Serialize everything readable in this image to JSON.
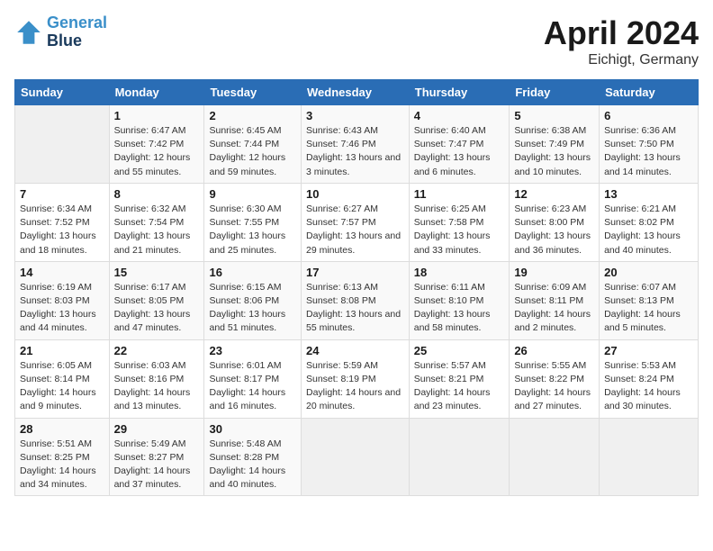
{
  "header": {
    "logo_line1": "General",
    "logo_line2": "Blue",
    "month": "April 2024",
    "location": "Eichigt, Germany"
  },
  "days_of_week": [
    "Sunday",
    "Monday",
    "Tuesday",
    "Wednesday",
    "Thursday",
    "Friday",
    "Saturday"
  ],
  "weeks": [
    [
      {
        "day": "",
        "sunrise": "",
        "sunset": "",
        "daylight": ""
      },
      {
        "day": "1",
        "sunrise": "Sunrise: 6:47 AM",
        "sunset": "Sunset: 7:42 PM",
        "daylight": "Daylight: 12 hours and 55 minutes."
      },
      {
        "day": "2",
        "sunrise": "Sunrise: 6:45 AM",
        "sunset": "Sunset: 7:44 PM",
        "daylight": "Daylight: 12 hours and 59 minutes."
      },
      {
        "day": "3",
        "sunrise": "Sunrise: 6:43 AM",
        "sunset": "Sunset: 7:46 PM",
        "daylight": "Daylight: 13 hours and 3 minutes."
      },
      {
        "day": "4",
        "sunrise": "Sunrise: 6:40 AM",
        "sunset": "Sunset: 7:47 PM",
        "daylight": "Daylight: 13 hours and 6 minutes."
      },
      {
        "day": "5",
        "sunrise": "Sunrise: 6:38 AM",
        "sunset": "Sunset: 7:49 PM",
        "daylight": "Daylight: 13 hours and 10 minutes."
      },
      {
        "day": "6",
        "sunrise": "Sunrise: 6:36 AM",
        "sunset": "Sunset: 7:50 PM",
        "daylight": "Daylight: 13 hours and 14 minutes."
      }
    ],
    [
      {
        "day": "7",
        "sunrise": "Sunrise: 6:34 AM",
        "sunset": "Sunset: 7:52 PM",
        "daylight": "Daylight: 13 hours and 18 minutes."
      },
      {
        "day": "8",
        "sunrise": "Sunrise: 6:32 AM",
        "sunset": "Sunset: 7:54 PM",
        "daylight": "Daylight: 13 hours and 21 minutes."
      },
      {
        "day": "9",
        "sunrise": "Sunrise: 6:30 AM",
        "sunset": "Sunset: 7:55 PM",
        "daylight": "Daylight: 13 hours and 25 minutes."
      },
      {
        "day": "10",
        "sunrise": "Sunrise: 6:27 AM",
        "sunset": "Sunset: 7:57 PM",
        "daylight": "Daylight: 13 hours and 29 minutes."
      },
      {
        "day": "11",
        "sunrise": "Sunrise: 6:25 AM",
        "sunset": "Sunset: 7:58 PM",
        "daylight": "Daylight: 13 hours and 33 minutes."
      },
      {
        "day": "12",
        "sunrise": "Sunrise: 6:23 AM",
        "sunset": "Sunset: 8:00 PM",
        "daylight": "Daylight: 13 hours and 36 minutes."
      },
      {
        "day": "13",
        "sunrise": "Sunrise: 6:21 AM",
        "sunset": "Sunset: 8:02 PM",
        "daylight": "Daylight: 13 hours and 40 minutes."
      }
    ],
    [
      {
        "day": "14",
        "sunrise": "Sunrise: 6:19 AM",
        "sunset": "Sunset: 8:03 PM",
        "daylight": "Daylight: 13 hours and 44 minutes."
      },
      {
        "day": "15",
        "sunrise": "Sunrise: 6:17 AM",
        "sunset": "Sunset: 8:05 PM",
        "daylight": "Daylight: 13 hours and 47 minutes."
      },
      {
        "day": "16",
        "sunrise": "Sunrise: 6:15 AM",
        "sunset": "Sunset: 8:06 PM",
        "daylight": "Daylight: 13 hours and 51 minutes."
      },
      {
        "day": "17",
        "sunrise": "Sunrise: 6:13 AM",
        "sunset": "Sunset: 8:08 PM",
        "daylight": "Daylight: 13 hours and 55 minutes."
      },
      {
        "day": "18",
        "sunrise": "Sunrise: 6:11 AM",
        "sunset": "Sunset: 8:10 PM",
        "daylight": "Daylight: 13 hours and 58 minutes."
      },
      {
        "day": "19",
        "sunrise": "Sunrise: 6:09 AM",
        "sunset": "Sunset: 8:11 PM",
        "daylight": "Daylight: 14 hours and 2 minutes."
      },
      {
        "day": "20",
        "sunrise": "Sunrise: 6:07 AM",
        "sunset": "Sunset: 8:13 PM",
        "daylight": "Daylight: 14 hours and 5 minutes."
      }
    ],
    [
      {
        "day": "21",
        "sunrise": "Sunrise: 6:05 AM",
        "sunset": "Sunset: 8:14 PM",
        "daylight": "Daylight: 14 hours and 9 minutes."
      },
      {
        "day": "22",
        "sunrise": "Sunrise: 6:03 AM",
        "sunset": "Sunset: 8:16 PM",
        "daylight": "Daylight: 14 hours and 13 minutes."
      },
      {
        "day": "23",
        "sunrise": "Sunrise: 6:01 AM",
        "sunset": "Sunset: 8:17 PM",
        "daylight": "Daylight: 14 hours and 16 minutes."
      },
      {
        "day": "24",
        "sunrise": "Sunrise: 5:59 AM",
        "sunset": "Sunset: 8:19 PM",
        "daylight": "Daylight: 14 hours and 20 minutes."
      },
      {
        "day": "25",
        "sunrise": "Sunrise: 5:57 AM",
        "sunset": "Sunset: 8:21 PM",
        "daylight": "Daylight: 14 hours and 23 minutes."
      },
      {
        "day": "26",
        "sunrise": "Sunrise: 5:55 AM",
        "sunset": "Sunset: 8:22 PM",
        "daylight": "Daylight: 14 hours and 27 minutes."
      },
      {
        "day": "27",
        "sunrise": "Sunrise: 5:53 AM",
        "sunset": "Sunset: 8:24 PM",
        "daylight": "Daylight: 14 hours and 30 minutes."
      }
    ],
    [
      {
        "day": "28",
        "sunrise": "Sunrise: 5:51 AM",
        "sunset": "Sunset: 8:25 PM",
        "daylight": "Daylight: 14 hours and 34 minutes."
      },
      {
        "day": "29",
        "sunrise": "Sunrise: 5:49 AM",
        "sunset": "Sunset: 8:27 PM",
        "daylight": "Daylight: 14 hours and 37 minutes."
      },
      {
        "day": "30",
        "sunrise": "Sunrise: 5:48 AM",
        "sunset": "Sunset: 8:28 PM",
        "daylight": "Daylight: 14 hours and 40 minutes."
      },
      {
        "day": "",
        "sunrise": "",
        "sunset": "",
        "daylight": ""
      },
      {
        "day": "",
        "sunrise": "",
        "sunset": "",
        "daylight": ""
      },
      {
        "day": "",
        "sunrise": "",
        "sunset": "",
        "daylight": ""
      },
      {
        "day": "",
        "sunrise": "",
        "sunset": "",
        "daylight": ""
      }
    ]
  ]
}
